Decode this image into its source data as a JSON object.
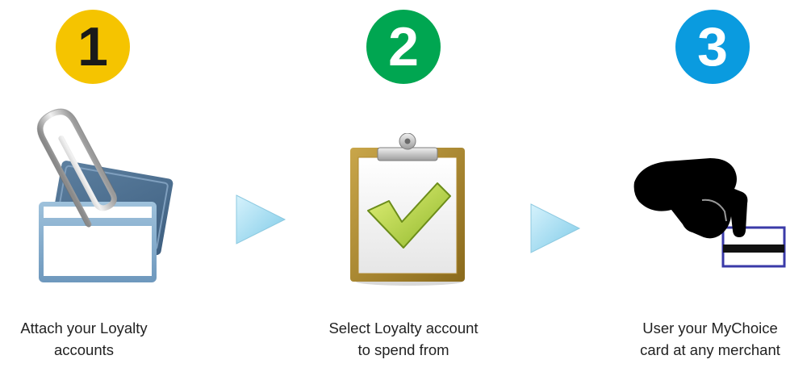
{
  "steps": [
    {
      "number": "1",
      "badge_color": "#F5C400",
      "number_color": "#1a1a1a",
      "icon": "paperclip-cards-icon",
      "caption": [
        "Attach your Loyalty",
        "accounts"
      ]
    },
    {
      "number": "2",
      "badge_color": "#00A651",
      "number_color": "#ffffff",
      "icon": "clipboard-checkmark-icon",
      "caption": [
        "Select Loyalty account",
        "to spend from"
      ]
    },
    {
      "number": "3",
      "badge_color": "#0A9BDF",
      "number_color": "#ffffff",
      "icon": "hand-swiping-card-icon",
      "caption": [
        "User your MyChoice",
        "card at any merchant"
      ]
    }
  ],
  "arrow_color": "#A8E1F5",
  "arrow_icon": "triangle-right-icon"
}
